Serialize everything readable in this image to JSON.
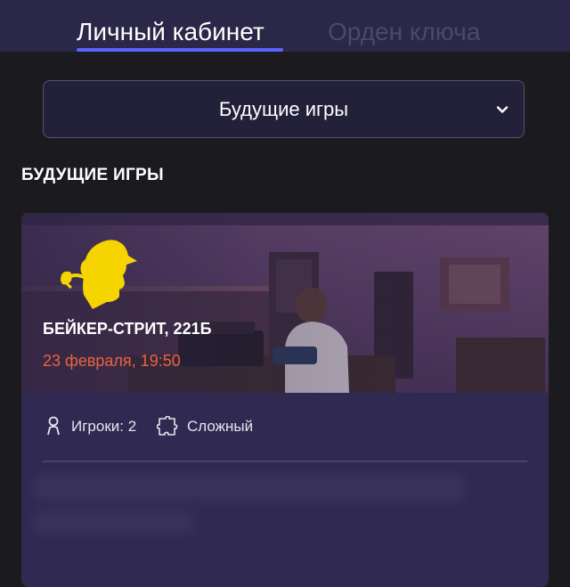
{
  "tabs": {
    "personal_account": "Личный кабинет",
    "key_order": "Орден ключа"
  },
  "filter": {
    "selected": "Будущие игры"
  },
  "section": {
    "heading": "БУДУЩИЕ ИГРЫ"
  },
  "game": {
    "title": "БЕЙКЕР-СТРИТ, 221Б",
    "datetime": "23 февраля, 19:50",
    "players_label": "Игроки: 2",
    "difficulty": "Сложный"
  },
  "colors": {
    "accent_underline": "#5b63ff",
    "date_color": "#e9643c",
    "logo_color": "#f5d400"
  },
  "icons": {
    "dropdown": "chevron-down-icon",
    "players": "person-icon",
    "difficulty": "puzzle-icon",
    "logo": "sherlock-silhouette-icon"
  }
}
